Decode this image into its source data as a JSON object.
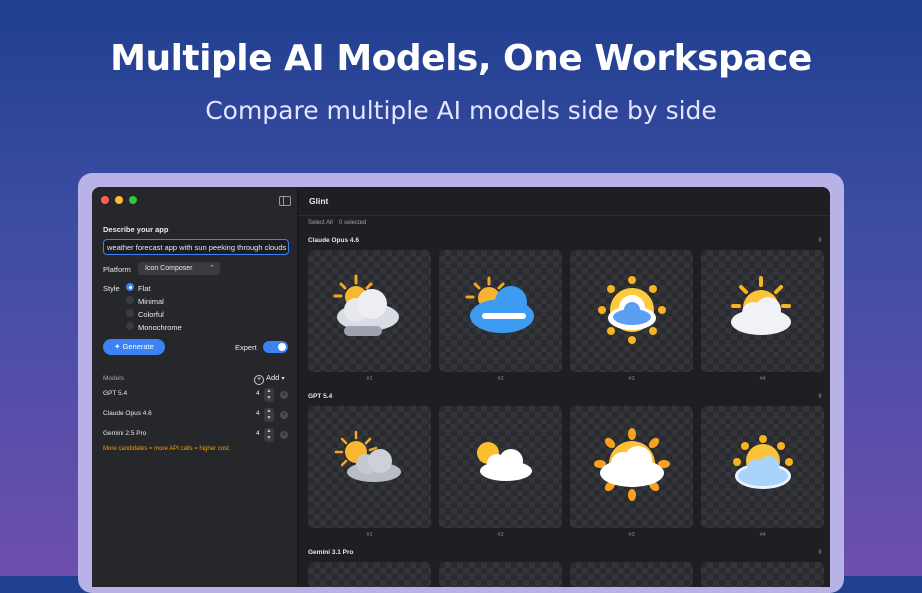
{
  "hero": {
    "title": "Multiple AI Models, One Workspace",
    "subtitle": "Compare multiple AI models side by side"
  },
  "colors": {
    "accent": "#3b82f6",
    "warning": "#f59e0b",
    "light_close": "#ff5f57",
    "light_min": "#febc2e",
    "light_max": "#28c840"
  },
  "sidebar": {
    "describe_label": "Describe your app",
    "prompt_value": "weather forecast app with sun peeking through clouds",
    "platform_label": "Platform",
    "platform_value": "Icon Composer",
    "style_label": "Style",
    "style_options": [
      "Flat",
      "Minimal",
      "Colorful",
      "Monochrome"
    ],
    "style_selected": "Flat",
    "generate_label": "Generate",
    "expert_label": "Expert",
    "expert_on": true,
    "models_label": "Models",
    "add_label": "Add",
    "models": [
      {
        "name": "GPT 5.4",
        "count": "4"
      },
      {
        "name": "Claude Opus 4.6",
        "count": "4"
      },
      {
        "name": "Gemini 2.5 Pro",
        "count": "4"
      }
    ],
    "warning": "More candidates = more API calls = higher cost."
  },
  "main": {
    "app_title": "Glint",
    "select_all": "Select All",
    "selected_count": "0 selected",
    "sections": [
      {
        "title": "Claude Opus 4.6",
        "items": [
          "#1",
          "#2",
          "#3",
          "#4"
        ]
      },
      {
        "title": "GPT 5.4",
        "items": [
          "#1",
          "#2",
          "#3",
          "#4"
        ]
      },
      {
        "title": "Gemini 3.1 Pro",
        "items": []
      }
    ]
  },
  "icons": {
    "sidebar_toggle": "sidebar-toggle-icon",
    "generate": "sparkle-icon",
    "pin": "pin-icon",
    "weather_cells": "sun-cloud-icon"
  }
}
